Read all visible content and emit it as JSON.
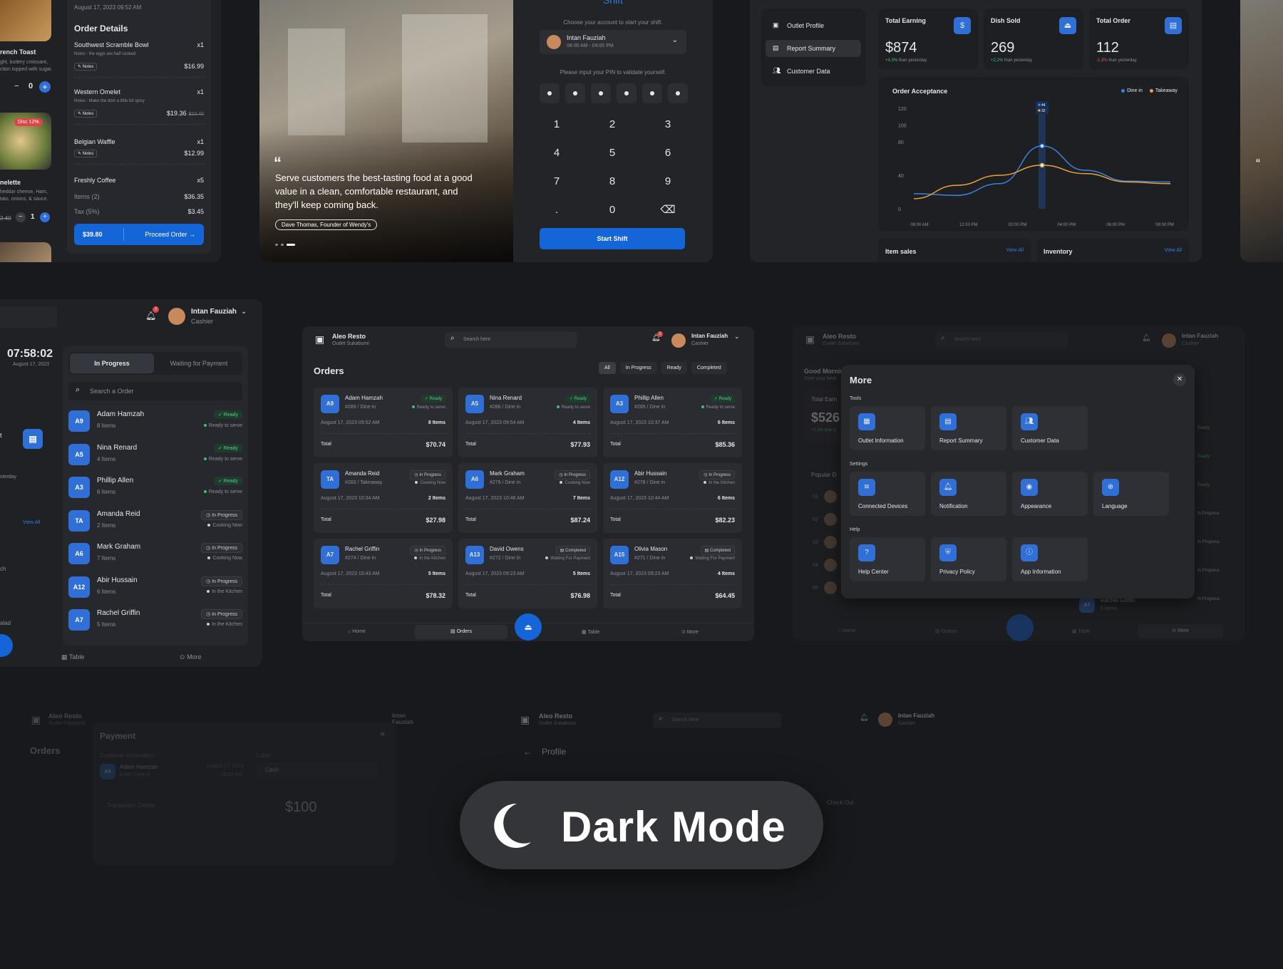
{
  "order_details": {
    "date": "August 17, 2023 09:52 AM",
    "title": "Order Details",
    "items": [
      {
        "name": "Southwest Scramble Bowl",
        "qty": "x1",
        "note": "Notes : the eggs are half cooked",
        "price": "$16.99",
        "old": ""
      },
      {
        "name": "Western Omelet",
        "qty": "x1",
        "note": "Notes : Make the dish a little bit spicy",
        "price": "$19.36",
        "old": "$22.40"
      },
      {
        "name": "Belgian Waffle",
        "qty": "x1",
        "note": "",
        "price": "$12.99",
        "old": ""
      },
      {
        "name": "Freshly Coffee",
        "qty": "x5",
        "note": "",
        "price": "",
        "old": ""
      }
    ],
    "notes_label": "Notes",
    "items_label": "Items (2)",
    "items_value": "$36.35",
    "tax_label": "Tax (5%)",
    "tax_value": "$3.45",
    "total": "$39.80",
    "proceed": "Proceed Order"
  },
  "left_menu": {
    "item1": "rench Toast",
    "item1_desc1": "ght, buttery croissant,",
    "item1_desc2": "ction topped with sugar.",
    "qty1": "0",
    "disc": "Disc 12%",
    "item2": "nelette",
    "item2_desc1": "heddar cheese, Ham,",
    "item2_desc2": "tato, onions, & sauce.",
    "price2": "2.40",
    "qty2": "1"
  },
  "hero": {
    "quote": "Serve customers the best-tasting food at a good value in a clean, comfortable restaurant, and they'll keep coming back.",
    "author": "Dave Thomas, Founder of Wendy's"
  },
  "login": {
    "title": "Shift",
    "choose": "Choose your account to start your shift.",
    "name": "Intan Fauziah",
    "time": "08:00 AM - 04:00 PM",
    "pin_label": "Please input your PIN to validate yourself.",
    "keys": [
      "1",
      "2",
      "3",
      "4",
      "5",
      "6",
      "7",
      "8",
      "9",
      ".",
      "0",
      "⌫"
    ],
    "start": "Start Shift"
  },
  "dashboard": {
    "menu": [
      "Outlet Profile",
      "Report Summary",
      "Customer Data"
    ],
    "stats": [
      {
        "label": "Total Earning",
        "value": "$874",
        "delta": "+4,3%",
        "sub": "than yesterday",
        "color": "#3fbf78"
      },
      {
        "label": "Dish Sold",
        "value": "269",
        "delta": "+2,2%",
        "sub": "than yesterday",
        "color": "#3fbf78"
      },
      {
        "label": "Total Order",
        "value": "112",
        "delta": "-1,3%",
        "sub": "than yesterday",
        "color": "#e25555"
      }
    ],
    "chart_title": "Order Acceptance",
    "legend": [
      "Dine in",
      "Takeaway"
    ],
    "tooltip": [
      "44",
      "32"
    ],
    "item_sales": "Item sales",
    "inventory": "Inventory",
    "view_all": "View All"
  },
  "chart_data": {
    "type": "line",
    "title": "Order Acceptance",
    "x": [
      "08:00 AM",
      "12:00 PM",
      "02:00 PM",
      "04:00 PM",
      "06:00 PM",
      "08:00 PM"
    ],
    "ylim": [
      0,
      120
    ],
    "yticks": [
      0,
      40,
      80,
      100,
      120
    ],
    "series": [
      {
        "name": "Dine in",
        "color": "#3b82e0",
        "values": [
          18,
          16,
          30,
          75,
          46,
          33,
          32
        ]
      },
      {
        "name": "Takeaway",
        "color": "#e8a23a",
        "values": [
          12,
          28,
          40,
          52,
          42,
          32,
          30
        ]
      }
    ],
    "legend": "top-right"
  },
  "in_progress": {
    "user": "Intan Fauziah",
    "role": "Cashier",
    "notif": "2",
    "clock": "07:58:02",
    "date": "August 17, 2023",
    "tab_active": "In Progress",
    "tab_other": "Waiting for Payment",
    "search": "Search a Order",
    "view_all": "View All",
    "yesterday": "sterday",
    "side_labels": [
      "t",
      "ch",
      "alad"
    ],
    "orders": [
      {
        "code": "A9",
        "name": "Adam Hamzah",
        "items": "8 Items",
        "badge": "Ready",
        "status": "Ready to serve",
        "ready": true
      },
      {
        "code": "A5",
        "name": "Nina Renard",
        "items": "4 Items",
        "badge": "Ready",
        "status": "Ready to serve",
        "ready": true
      },
      {
        "code": "A3",
        "name": "Phillip Allen",
        "items": "6 Items",
        "badge": "Ready",
        "status": "Ready to serve",
        "ready": true
      },
      {
        "code": "TA",
        "name": "Amanda Reid",
        "items": "2 Items",
        "badge": "In Progress",
        "status": "Cooking Now",
        "ready": false
      },
      {
        "code": "A6",
        "name": "Mark Graham",
        "items": "7 Items",
        "badge": "In Progress",
        "status": "Cooking Now",
        "ready": false
      },
      {
        "code": "A12",
        "name": "Abir Hussain",
        "items": "6 Items",
        "badge": "In Progress",
        "status": "In the Kitchen",
        "ready": false
      },
      {
        "code": "A7",
        "name": "Rachel Griffin",
        "items": "5 Items",
        "badge": "In Progress",
        "status": "In the Kitchen",
        "ready": false
      }
    ],
    "nav": [
      "Table",
      "More"
    ]
  },
  "orders_page": {
    "brand": "Aleo Resto",
    "outlet": "Outlet Sukabumi",
    "search": "Search here",
    "user": "Intan Fauziah",
    "role": "Cashier",
    "notif": "2",
    "title": "Orders",
    "filters": [
      "All",
      "In Progress",
      "Ready",
      "Completed"
    ],
    "total_label": "Total",
    "cards": [
      {
        "code": "A9",
        "name": "Adam Hamzah",
        "table": "#289 / Dine in",
        "badge": "Ready",
        "status": "Ready to serve",
        "date": "August 17, 2023 09:52 AM",
        "items": "8 Items",
        "total": "$70.74",
        "kind": "ready"
      },
      {
        "code": "A5",
        "name": "Nina Renard",
        "table": "#286 / Dine in",
        "badge": "Ready",
        "status": "Ready to serve",
        "date": "August 17, 2023 09:54 AM",
        "items": "4 Items",
        "total": "$77.93",
        "kind": "ready"
      },
      {
        "code": "A3",
        "name": "Phillip Allen",
        "table": "#285 / Dine in",
        "badge": "Ready",
        "status": "Ready to serve",
        "date": "August 17, 2023 10:37 AM",
        "items": "6 Items",
        "total": "$85.36",
        "kind": "ready"
      },
      {
        "code": "TA",
        "name": "Amanda Reid",
        "table": "#283 / Takeaway",
        "badge": "In Progress",
        "status": "Cooking Now",
        "date": "August 17, 2023 10:34 AM",
        "items": "2 Items",
        "total": "$27.98",
        "kind": "prog"
      },
      {
        "code": "A6",
        "name": "Mark Graham",
        "table": "#279 / Dine in",
        "badge": "In Progress",
        "status": "Cooking Now",
        "date": "August 17, 2023 10:48 AM",
        "items": "7 Items",
        "total": "$87.24",
        "kind": "prog"
      },
      {
        "code": "A12",
        "name": "Abir Hussain",
        "table": "#278 / Dine in",
        "badge": "In Progress",
        "status": "In the Kitchen",
        "date": "August 17, 2023 10:44 AM",
        "items": "6 Items",
        "total": "$82.23",
        "kind": "prog"
      },
      {
        "code": "A7",
        "name": "Rachel Griffin",
        "table": "#274 / Dine in",
        "badge": "In Progress",
        "status": "In the Kitchen",
        "date": "August 17, 2023 10:43 AM",
        "items": "5 Items",
        "total": "$78.32",
        "kind": "prog"
      },
      {
        "code": "A13",
        "name": "David Owens",
        "table": "#272 / Dine in",
        "badge": "Completed",
        "status": "Waiting For Payment",
        "date": "August 17, 2023 09:23 AM",
        "items": "5 Items",
        "total": "$76.98",
        "kind": "done"
      },
      {
        "code": "A15",
        "name": "Olivia Mason",
        "table": "#271 / Dine in",
        "badge": "Completed",
        "status": "Waiting For Payment",
        "date": "August 17, 2023 09:23 AM",
        "items": "4 Items",
        "total": "$64.45",
        "kind": "done"
      }
    ],
    "nav": [
      "Home",
      "Orders",
      "Table",
      "More"
    ]
  },
  "more_modal": {
    "brand": "Aleo Resto",
    "outlet": "Outlet Sukabumi",
    "search": "Search here",
    "user": "Intan Fauziah",
    "role": "Cashier",
    "greet": "Good Mornin",
    "greet_sub": "Give your best",
    "earn": "Total Earn",
    "earn_val": "$526",
    "earn_delta": "+3,2% than y",
    "popular": "Popular D",
    "ranks": [
      "01",
      "02",
      "03",
      "04",
      "05"
    ],
    "bg_list": [
      "Ready",
      "Ready",
      "Ready",
      "In Progress",
      "In Progress",
      "In Progress",
      "In Progress",
      "In Progress"
    ],
    "bg_name": "Rachel Griffin",
    "bg_items": "5 Items",
    "bg_status": "In the Kitchen",
    "bg_payment": "ayment",
    "title": "More",
    "tools_label": "Tools",
    "tools": [
      "Outlet Information",
      "Report Summary",
      "Customer Data"
    ],
    "settings_label": "Settings",
    "settings": [
      "Connected Devices",
      "Notification",
      "Appearance",
      "Language"
    ],
    "help_label": "Help",
    "help": [
      "Help Center",
      "Privacy Policy",
      "App Information"
    ],
    "nav": [
      "Home",
      "Orders",
      "Table",
      "More"
    ]
  },
  "payment": {
    "brand": "Aleo Resto",
    "outlet": "Outlet Sukabumi",
    "user": "Intan Fauziah",
    "role": "Cashier",
    "title": "Payment",
    "orders": "Orders",
    "customer_info": "Customer Information",
    "label": "Label",
    "method": "Cash",
    "customer": "Adam Hamzah",
    "table": "#289 / Dine in",
    "date": "August 17, 2023",
    "time": "09:52 AM",
    "trans": "Transaction Details",
    "amount": "$100"
  },
  "profile": {
    "brand": "Aleo Resto",
    "outlet": "Outlet Sukabumi",
    "search": "Search here",
    "user": "Intan Fauziah",
    "role": "Cashier",
    "title": "Profile",
    "check_out": "Check Out"
  },
  "pill": {
    "label": "Dark Mode"
  }
}
